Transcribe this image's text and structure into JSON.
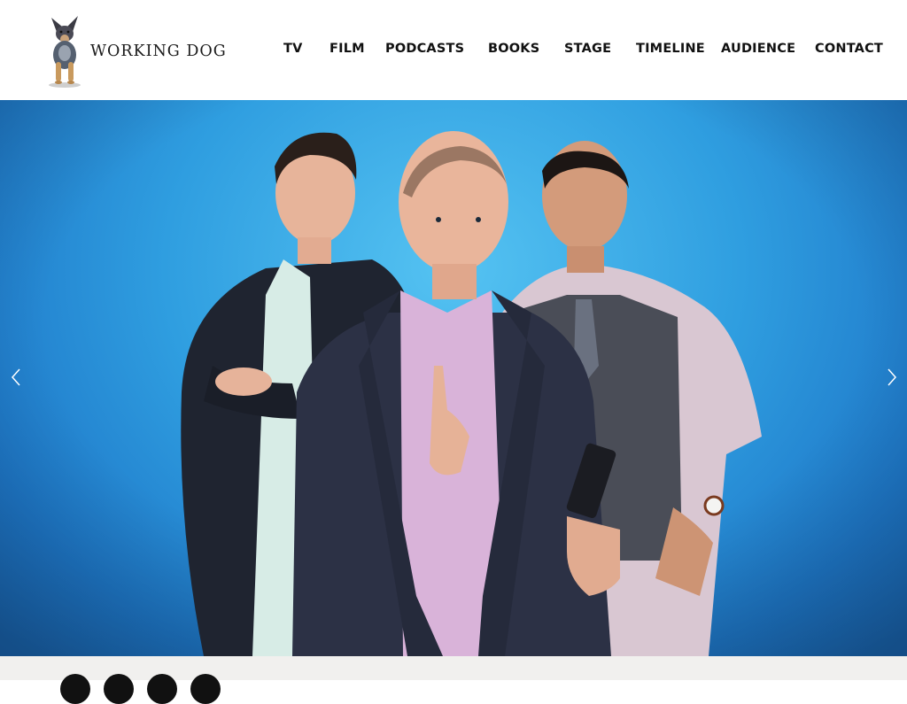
{
  "brand": {
    "name": "WORKING DOG",
    "logo_icon": "cattle-dog-icon"
  },
  "nav": {
    "items": [
      {
        "label": "TV"
      },
      {
        "label": "FILM"
      },
      {
        "label": "PODCASTS"
      },
      {
        "label": "BOOKS"
      },
      {
        "label": "STAGE"
      },
      {
        "label": "TIMELINE"
      },
      {
        "label": "AUDIENCE"
      },
      {
        "label": "CONTACT"
      }
    ]
  },
  "hero": {
    "prev_icon": "chevron-left-icon",
    "next_icon": "chevron-right-icon",
    "background_color": "#2f9ee0"
  },
  "footer": {
    "social_icons": [
      "social-icon-1",
      "social-icon-2",
      "social-icon-3",
      "social-icon-4"
    ]
  }
}
